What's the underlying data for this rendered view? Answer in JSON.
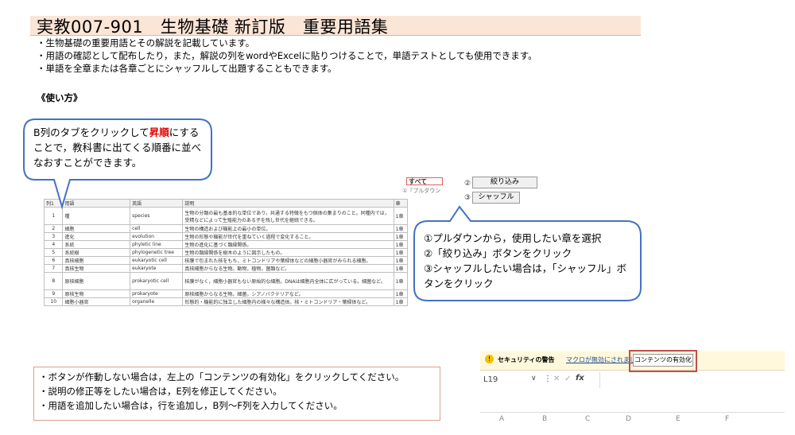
{
  "title": "実教007-901　生物基礎 新訂版　重要用語集",
  "bullets": [
    "・生物基礎の重要用語とその解説を記載しています。",
    "・用語の確認として配布したり，また，解説の列をwordやExcelに貼りつけることで，単語テストとしても使用できます。",
    "・単語を全章または各章ごとにシャッフルして出題することもできます。"
  ],
  "howto_heading": "《使い方》",
  "callout1": {
    "pre": "B列のタブをクリックして",
    "highlight": "昇順",
    "post": "にすることで，教科書に出てくる順番に並べなおすことができます。"
  },
  "callout2": [
    "①プルダウンから，使用したい章を選択",
    "②「絞り込み」ボタンをクリック",
    "③シャッフルしたい場合は，「シャッフル」ボタンをクリック"
  ],
  "sheet": {
    "headers": [
      "列1",
      "用語",
      "英語",
      "説明",
      "章"
    ],
    "rows": [
      {
        "no": "1",
        "term": "種",
        "en": "species",
        "desc": "生物の分類の最も基本的な単位であり，共通する特徴をもつ個体の集まりのこと。同種内では，受精などによって生殖能力のある子を残し世代を継続できる。",
        "ch": "1章"
      },
      {
        "no": "2",
        "term": "細胞",
        "en": "cell",
        "desc": "生物の構造および機能上の最小の単位。",
        "ch": "1章"
      },
      {
        "no": "3",
        "term": "進化",
        "en": "evolution",
        "desc": "生物の形態や機能が世代を重ねていく過程で変化すること。",
        "ch": "1章"
      },
      {
        "no": "4",
        "term": "系統",
        "en": "phyletic line",
        "desc": "生物の進化に基づく類縁関係。",
        "ch": "1章"
      },
      {
        "no": "5",
        "term": "系統樹",
        "en": "phylogenetic tree",
        "desc": "生物の類縁関係を樹木のように図示したもの。",
        "ch": "1章"
      },
      {
        "no": "6",
        "term": "真核細胞",
        "en": "eukaryotic cell",
        "desc": "核膜で包まれた核をもち，ミトコンドリアや葉緑体などの細胞小器官がみられる細胞。",
        "ch": "1章"
      },
      {
        "no": "7",
        "term": "真核生物",
        "en": "eukaryote",
        "desc": "真核細胞からなる生物。動物，植物，菌類など。",
        "ch": "1章"
      },
      {
        "no": "8",
        "term": "原核細胞",
        "en": "prokaryotic cell",
        "desc": "核膜がなく，細胞小器官もない原始的な細胞。DNAは細胞内全体に広がっている。細菌など。",
        "ch": "1章"
      },
      {
        "no": "9",
        "term": "原核生物",
        "en": "prokaryote",
        "desc": "原核細胞からなる生物。細菌，シアノバクテリアなど。",
        "ch": "1章"
      },
      {
        "no": "10",
        "term": "細胞小器官",
        "en": "organelle",
        "desc": "形態的・機能的に独立した細胞内の様々な構造体。核・ミトコンドリア・葉緑体など。",
        "ch": "1章"
      }
    ]
  },
  "controls": {
    "dropdown_value": "すべて",
    "dropdown_hint": "①『プルダウン",
    "filter_num": "②",
    "filter_label": "絞り込み",
    "shuffle_num": "③",
    "shuffle_label": "シャッフル"
  },
  "notes": [
    "・ボタンが作動しない場合は，左上の「コンテンツの有効化」をクリックしてください。",
    "・説明の修正等をしたい場合は，E列を修正してください。",
    "・用語を追加したい場合は，行を追加し，B列～F列を入力してください。"
  ],
  "excel": {
    "security_label": "セキュリティの警告",
    "security_msg": "マクロが無効にされました。",
    "enable_button": "コンテンツの有効化",
    "cell_ref": "L19",
    "fx": "fx",
    "columns": [
      "A",
      "B",
      "C",
      "D",
      "E",
      "F"
    ]
  },
  "colors": {
    "accent": "#4472c4",
    "title_bg": "#fbe5d6",
    "highlight": "#e00000",
    "warn_border": "#c0504d"
  }
}
